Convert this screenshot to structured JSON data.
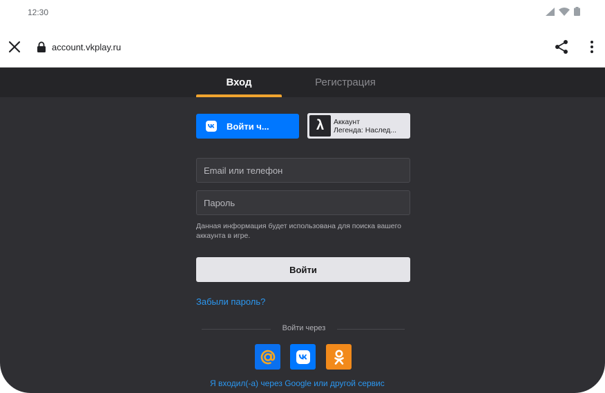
{
  "status_bar": {
    "time": "12:30"
  },
  "browser": {
    "url": "account.vkplay.ru"
  },
  "tabs": {
    "login": "Вход",
    "register": "Регистрация"
  },
  "auth_buttons": {
    "vk_label": "Войти ч...",
    "legend_line1": "Аккаунт",
    "legend_line2": "Легенда: Наслед..."
  },
  "form": {
    "email_placeholder": "Email или телефон",
    "password_placeholder": "Пароль",
    "hint": "Данная информация будет использована для поиска вашего аккаунта в игре.",
    "submit_label": "Войти",
    "forgot_label": "Забыли пароль?"
  },
  "social": {
    "via_label": "Войти через",
    "services": [
      "mail-ru-icon",
      "vk-icon",
      "ok-icon"
    ],
    "alt_login_label": "Я входил(-а) через Google или другой сервис"
  },
  "colors": {
    "accent_orange": "#f0a42f",
    "vk_blue": "#0077ff",
    "link_blue": "#2b97f0",
    "ok_orange": "#f28a1b",
    "background": "#2f2f33"
  }
}
